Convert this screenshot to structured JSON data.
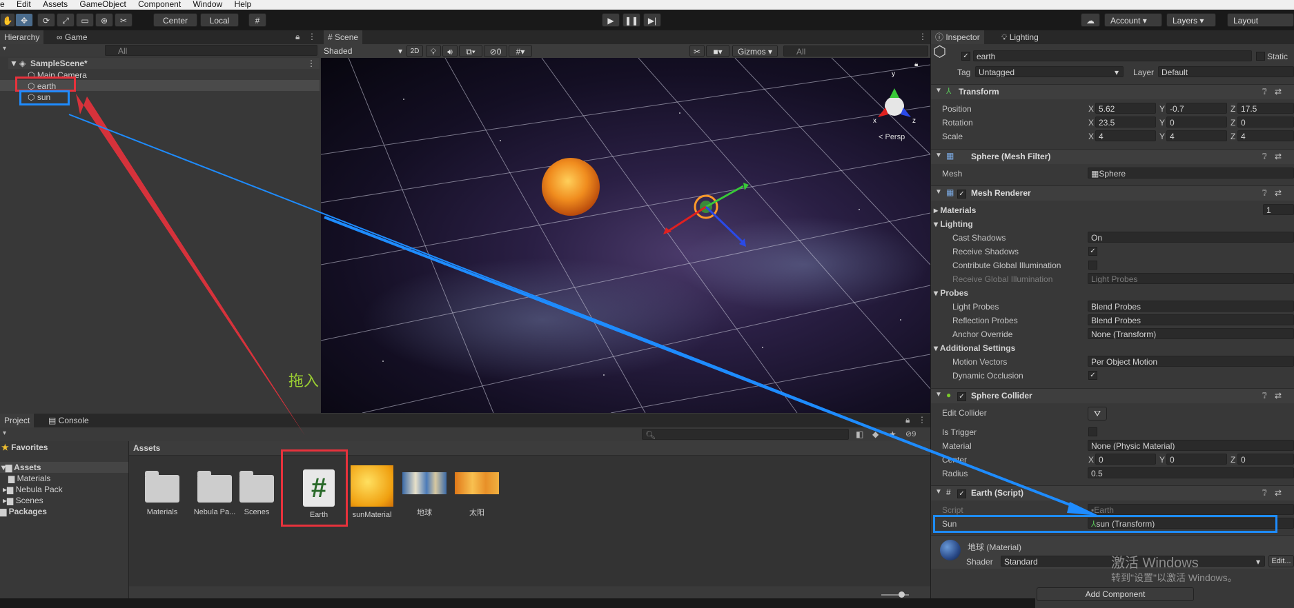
{
  "menu": [
    "e",
    "Edit",
    "Assets",
    "GameObject",
    "Component",
    "Window",
    "Help"
  ],
  "toolbar": {
    "center": "Center",
    "local": "Local",
    "account": "Account",
    "layers": "Layers",
    "layout": "Layout"
  },
  "hierarchy": {
    "tab_hierarchy": "Hierarchy",
    "tab_game": "Game",
    "search": "All",
    "scene": "SampleScene*",
    "items": [
      "Main Camera",
      "earth",
      "sun"
    ]
  },
  "scene": {
    "tab": "Scene",
    "shading": "Shaded",
    "mode2d": "2D",
    "hidden_count": "0",
    "gizmos": "Gizmos",
    "search": "All",
    "persp": "< Persp",
    "axis_y": "y",
    "axis_x": "x",
    "axis_z": "z"
  },
  "annotation": {
    "text": "拖入"
  },
  "project": {
    "tab_project": "Project",
    "tab_console": "Console",
    "favorites": "Favorites",
    "assets_root": "Assets",
    "folders": [
      "Materials",
      "Nebula Pack",
      "Scenes"
    ],
    "packages": "Packages",
    "breadcrumb": "Assets",
    "hidden_count": "9",
    "assets": [
      "Materials",
      "Nebula Pa...",
      "Scenes",
      "Earth",
      "sunMaterial",
      "地球",
      "太阳"
    ]
  },
  "inspector": {
    "tab_inspector": "Inspector",
    "tab_lighting": "Lighting",
    "object_name": "earth",
    "static": "Static",
    "tag_label": "Tag",
    "tag_value": "Untagged",
    "layer_label": "Layer",
    "layer_value": "Default",
    "transform": {
      "title": "Transform",
      "position_label": "Position",
      "rotation_label": "Rotation",
      "scale_label": "Scale",
      "position": [
        "5.62",
        "-0.7",
        "17.5"
      ],
      "rotation": [
        "23.5",
        "0",
        "0"
      ],
      "scale": [
        "4",
        "4",
        "4"
      ]
    },
    "mesh_filter": {
      "title": "Sphere (Mesh Filter)",
      "mesh_label": "Mesh",
      "mesh_value": "Sphere"
    },
    "mesh_renderer": {
      "title": "Mesh Renderer",
      "materials_label": "Materials",
      "materials_count": "1",
      "lighting": "Lighting",
      "cast_shadows_label": "Cast Shadows",
      "cast_shadows_value": "On",
      "receive_shadows_label": "Receive Shadows",
      "contribute_gi_label": "Contribute Global Illumination",
      "receive_gi_label": "Receive Global Illumination",
      "receive_gi_value": "Light Probes",
      "probes": "Probes",
      "light_probes_label": "Light Probes",
      "light_probes_value": "Blend Probes",
      "reflection_probes_label": "Reflection Probes",
      "reflection_probes_value": "Blend Probes",
      "anchor_override_label": "Anchor Override",
      "anchor_override_value": "None (Transform)",
      "additional_settings": "Additional Settings",
      "motion_vectors_label": "Motion Vectors",
      "motion_vectors_value": "Per Object Motion",
      "dynamic_occlusion_label": "Dynamic Occlusion"
    },
    "collider": {
      "title": "Sphere Collider",
      "edit_collider": "Edit Collider",
      "is_trigger": "Is Trigger",
      "material_label": "Material",
      "material_value": "None (Physic Material)",
      "center_label": "Center",
      "center": [
        "0",
        "0",
        "0"
      ],
      "radius_label": "Radius",
      "radius_value": "0.5"
    },
    "script": {
      "title": "Earth (Script)",
      "script_label": "Script",
      "script_value": "Earth",
      "sun_label": "Sun",
      "sun_value": "sun (Transform)"
    },
    "material": {
      "title": "地球 (Material)",
      "shader_label": "Shader",
      "shader_value": "Standard",
      "edit": "Edit..."
    },
    "add_component": "Add Component"
  },
  "watermark": {
    "line1": "激活 Windows",
    "line2": "转到\"设置\"以激活 Windows。"
  },
  "colors": {
    "red_box": "#e8323c",
    "blue_box": "#1e8cff",
    "annotation": "#9acd32"
  }
}
